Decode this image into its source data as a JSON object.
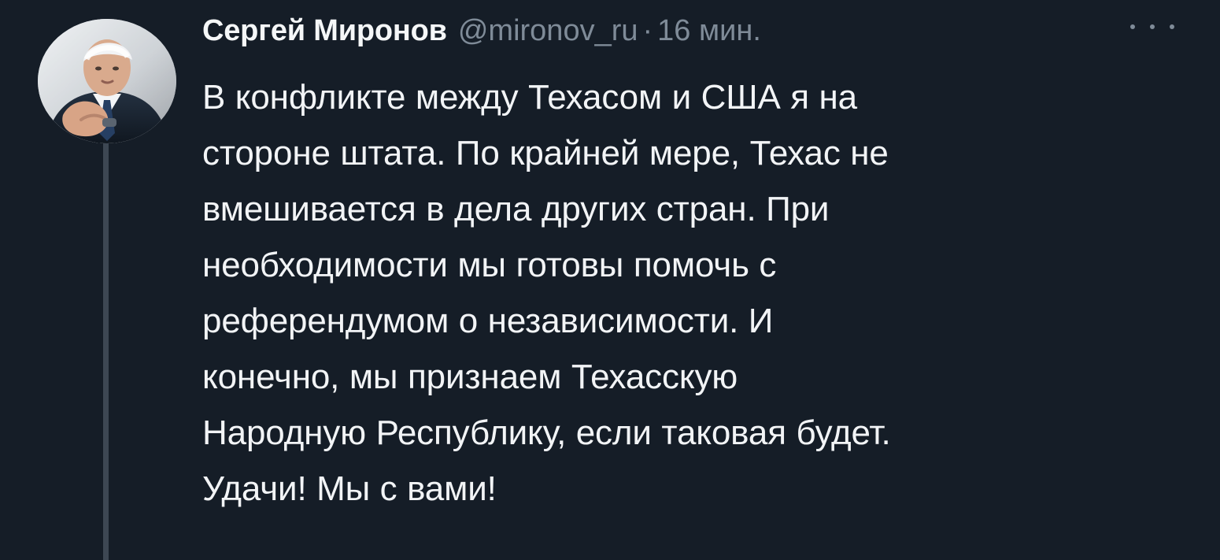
{
  "tweet": {
    "author": {
      "display_name": "Сергей Миронов",
      "handle": "@mironov_ru",
      "avatar": "avatar"
    },
    "separator": "·",
    "timestamp": "16 мин.",
    "more_icon": "more-icon",
    "body_lines": [
      "В конфликте между Техасом и США я на",
      "стороне штата. По крайней мере, Техас не",
      "вмешивается в дела других стран. При",
      "необходимости мы готовы помочь с",
      "референдумом о независимости. И",
      "конечно, мы признаем Техасскую",
      "Народную Республику, если таковая будет.",
      "Удачи! Мы с вами!"
    ]
  },
  "colors": {
    "background": "#151d27",
    "text_primary": "#f2f4f6",
    "text_secondary": "#7f8b98",
    "thread_line": "#3d4753"
  }
}
